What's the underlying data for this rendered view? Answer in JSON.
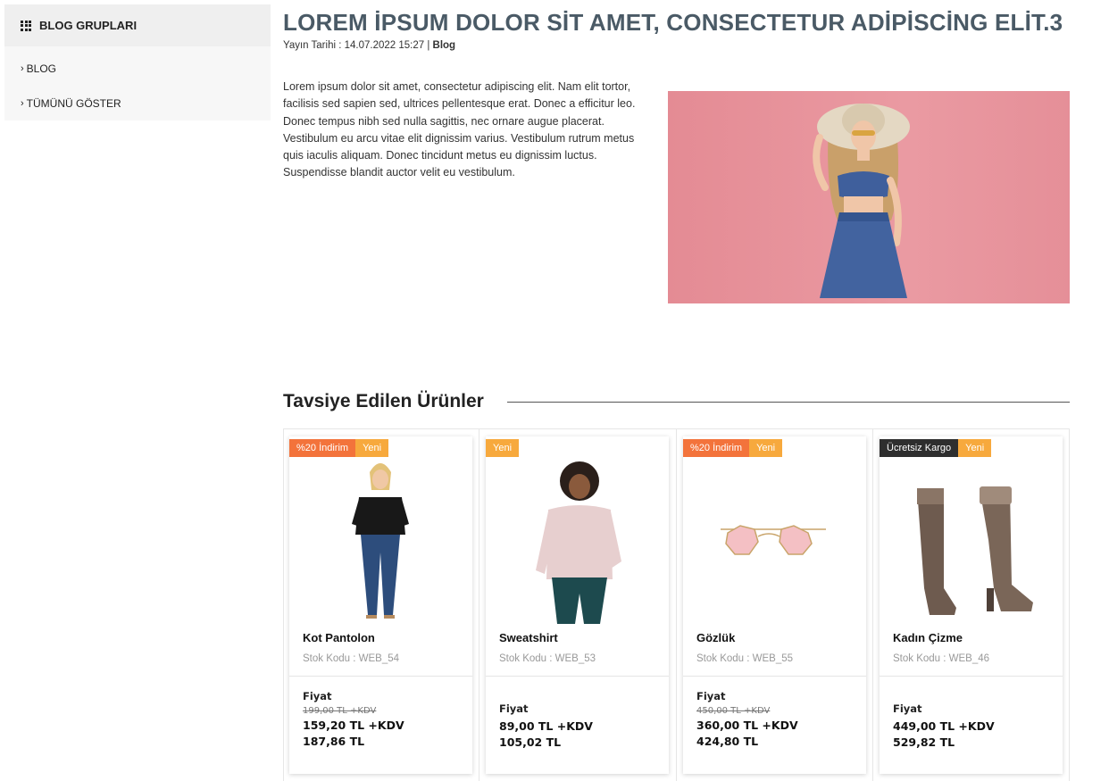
{
  "sidebar": {
    "title": "BLOG GRUPLARI",
    "items": [
      {
        "label": "BLOG"
      },
      {
        "label": "TÜMÜNÜ GÖSTER"
      }
    ]
  },
  "article": {
    "title": "LOREM İPSUM DOLOR SİT AMET, CONSECTETUR ADİPİSCİNG ELİT.3",
    "date_prefix": "Yayın Tarihi : 14.07.2022 15:27 |",
    "category": "Blog",
    "body": "Lorem ipsum dolor sit amet, consectetur adipiscing elit. Nam elit tortor, facilisis sed sapien sed, ultrices pellentesque erat. Donec a efficitur leo. Donec tempus nibh sed nulla sagittis, nec ornare augue placerat. Vestibulum eu arcu vitae elit dignissim varius. Vestibulum rutrum metus quis iaculis aliquam. Donec tincidunt metus eu dignissim luctus. Suspendisse blandit auctor velit eu vestibulum."
  },
  "recommended": {
    "title": "Tavsiye Edilen Ürünler",
    "products": [
      {
        "badges": [
          {
            "text": "%20 İndirim",
            "type": "discount"
          },
          {
            "text": "Yeni",
            "type": "new"
          }
        ],
        "name": "Kot Pantolon",
        "sku": "Stok Kodu : WEB_54",
        "price_label": "Fiyat",
        "old_price": "199,00 TL +KDV",
        "price": "159,20 TL +KDV",
        "price_incl": "187,86 TL"
      },
      {
        "badges": [
          {
            "text": "Yeni",
            "type": "new"
          }
        ],
        "name": "Sweatshirt",
        "sku": "Stok Kodu : WEB_53",
        "price_label": "Fiyat",
        "old_price": "",
        "price": "89,00 TL +KDV",
        "price_incl": "105,02 TL"
      },
      {
        "badges": [
          {
            "text": "%20 İndirim",
            "type": "discount"
          },
          {
            "text": "Yeni",
            "type": "new"
          }
        ],
        "name": "Gözlük",
        "sku": "Stok Kodu : WEB_55",
        "price_label": "Fiyat",
        "old_price": "450,00 TL +KDV",
        "price": "360,00 TL +KDV",
        "price_incl": "424,80 TL"
      },
      {
        "badges": [
          {
            "text": "Ücretsiz Kargo",
            "type": "cargo"
          },
          {
            "text": "Yeni",
            "type": "new"
          }
        ],
        "name": "Kadın Çizme",
        "sku": "Stok Kodu : WEB_46",
        "price_label": "Fiyat",
        "old_price": "",
        "price": "449,00 TL +KDV",
        "price_incl": "529,82 TL"
      }
    ]
  },
  "colors": {
    "title": "#4a5a66",
    "discount_badge": "#f3733b",
    "new_badge": "#f7a93d",
    "cargo_badge": "#2e2e2e",
    "hero_bg": "#e8949c"
  }
}
